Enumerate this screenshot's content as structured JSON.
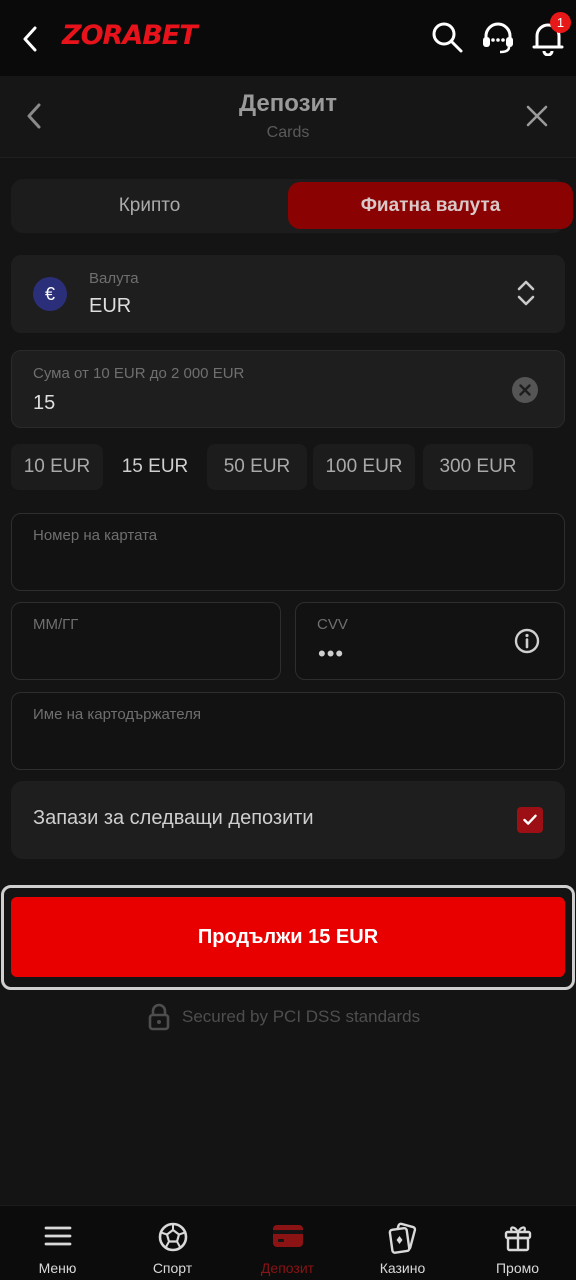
{
  "header": {
    "logo_left": "ZORA",
    "logo_right": "BET",
    "notification_count": "1"
  },
  "modal": {
    "title": "Депозит",
    "subtitle": "Cards"
  },
  "tabs": [
    {
      "label": "Крипто"
    },
    {
      "label": "Фиатна валута"
    }
  ],
  "currency": {
    "label": "Валута",
    "value": "EUR",
    "symbol": "€"
  },
  "amount": {
    "label": "Сума от 10 EUR до 2 000 EUR",
    "value": "15"
  },
  "quick_amounts": [
    "10 EUR",
    "15 EUR",
    "50 EUR",
    "100 EUR",
    "300 EUR"
  ],
  "card": {
    "number_placeholder": "Номер на картата",
    "expiry_placeholder": "ММ/ГГ",
    "cvv_label": "CVV",
    "cvv_value": "•••",
    "holder_placeholder": "Име на картодържателя"
  },
  "save": {
    "label": "Запази за следващи депозити",
    "checked": true
  },
  "cta": {
    "label": "Продължи 15 EUR"
  },
  "secured": {
    "label": "Secured by PCI DSS standards"
  },
  "nav": [
    {
      "label": "Меню"
    },
    {
      "label": "Спорт"
    },
    {
      "label": "Депозит"
    },
    {
      "label": "Казино"
    },
    {
      "label": "Промо"
    }
  ],
  "colors": {
    "accent": "#e80000",
    "active_tab": "#8a0202",
    "active_nav": "#8b1313",
    "checkbox": "#9c0f14"
  }
}
